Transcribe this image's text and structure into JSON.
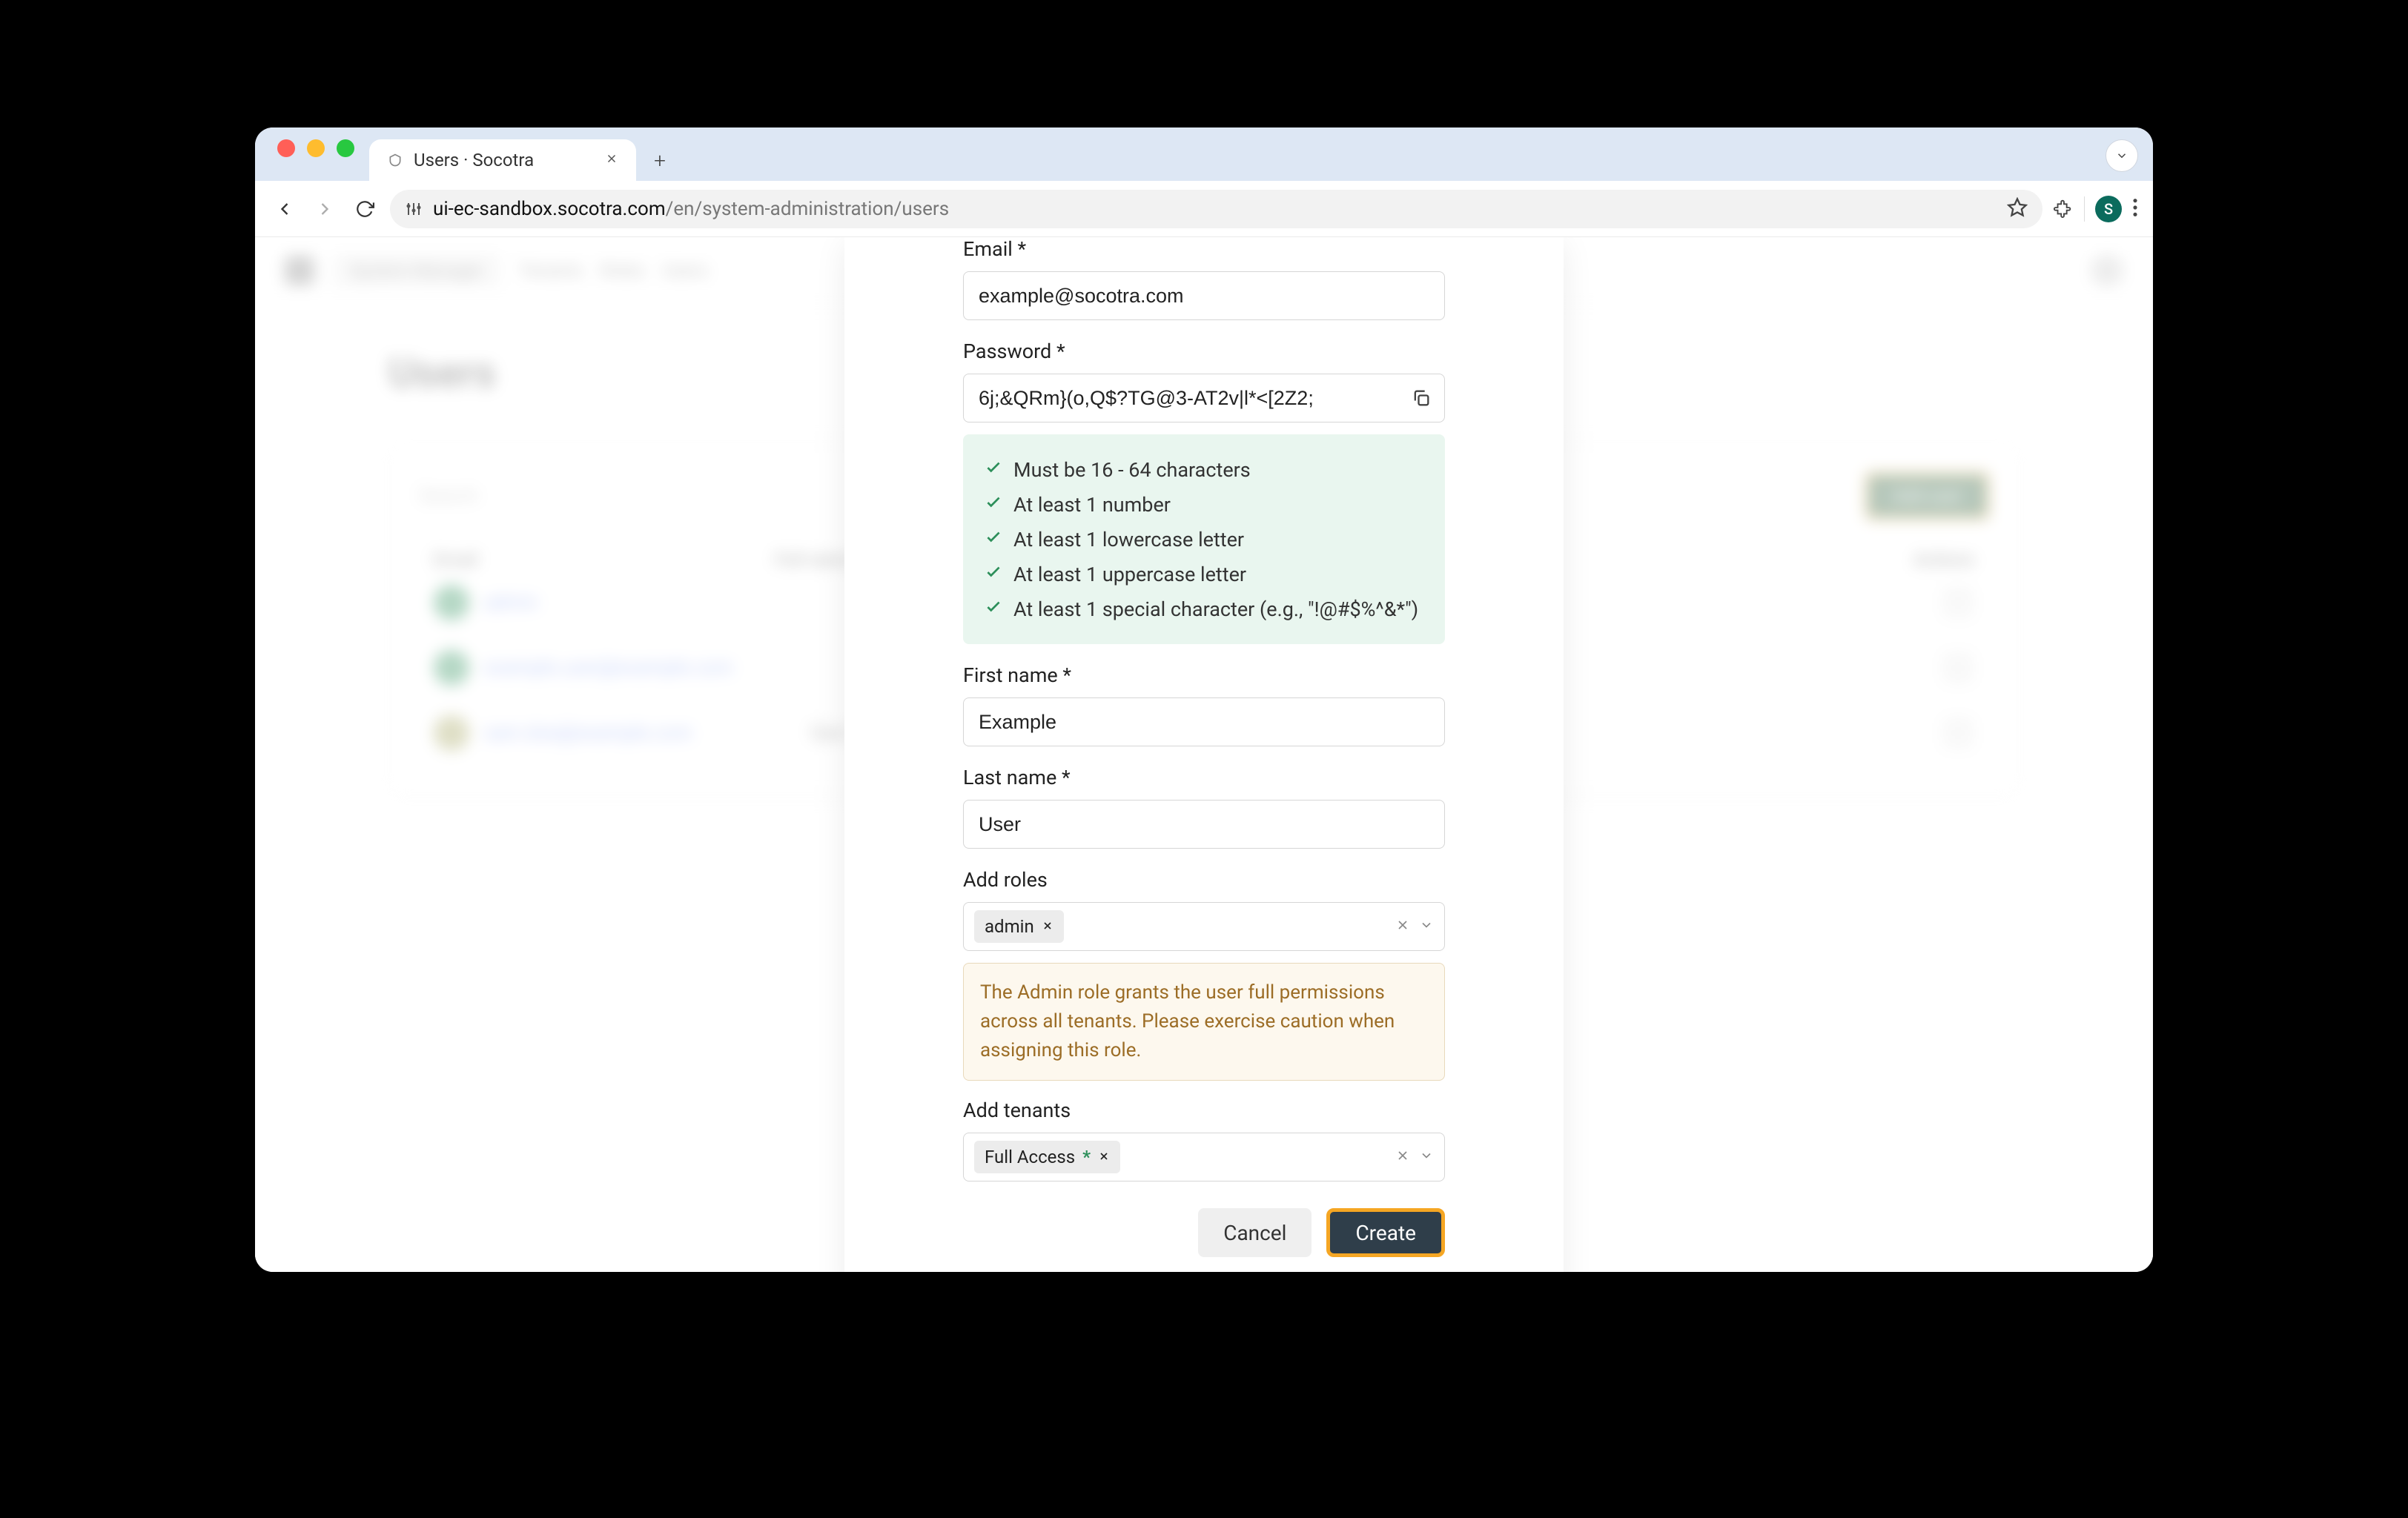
{
  "browser": {
    "tab_title": "Users · Socotra",
    "url_host": "ui-ec-sandbox.socotra.com",
    "url_path": "/en/system-administration/users",
    "profile_initial": "S"
  },
  "background": {
    "nav_chip": "System Manager",
    "nav_links": [
      "Tenants",
      "Roles",
      "Users"
    ],
    "page_title": "Users",
    "search_placeholder": "Search",
    "add_button": "Add user",
    "columns": {
      "email": "Email",
      "name": "Full name",
      "actions": "Actions"
    },
    "rows": [
      {
        "email": "admin",
        "name": ""
      },
      {
        "email": "example.user@example.com",
        "name": ""
      },
      {
        "email": "sam.doe@example.com",
        "name": "Sam Doe"
      }
    ]
  },
  "dialog": {
    "email_label": "Email *",
    "email_value": "example@socotra.com",
    "password_label": "Password *",
    "password_value": "6j;&QRm}(o,Q$?TG@3-AT2v|l*<[2Z2;",
    "rules": [
      "Must be 16 - 64 characters",
      "At least 1 number",
      "At least 1 lowercase letter",
      "At least 1 uppercase letter",
      "At least 1 special character (e.g., \"!@#$%^&*\")"
    ],
    "first_name_label": "First name *",
    "first_name_value": "Example",
    "last_name_label": "Last name *",
    "last_name_value": "User",
    "roles_label": "Add roles",
    "roles_chip": "admin",
    "roles_warning": "The Admin role grants the user full permissions across all tenants. Please exercise caution when assigning this role.",
    "tenants_label": "Add tenants",
    "tenants_chip": "Full Access",
    "tenants_chip_star": "*",
    "cancel": "Cancel",
    "create": "Create"
  }
}
